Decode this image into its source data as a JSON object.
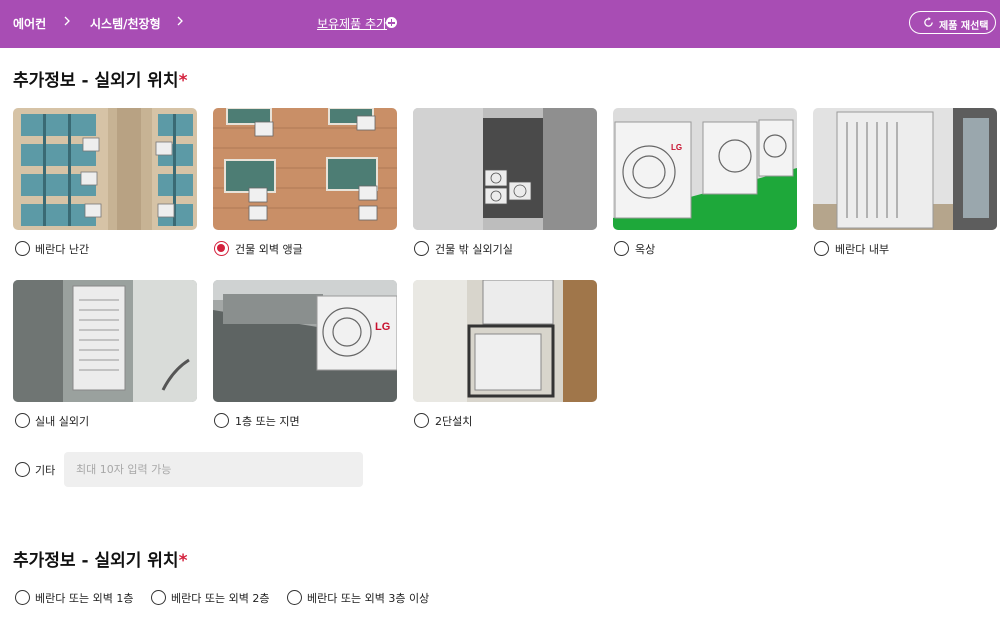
{
  "header": {
    "breadcrumb": [
      "에어컨",
      "시스템/천장형"
    ],
    "add_product": "보유제품 추가",
    "reselect": "제품 재선택"
  },
  "section1": {
    "title": "추가정보 - 실외기 위치",
    "required_mark": "*",
    "options": [
      {
        "label": "베란다 난간",
        "selected": false
      },
      {
        "label": "건물 외벽 앵글",
        "selected": true
      },
      {
        "label": "건물 밖 실외기실",
        "selected": false
      },
      {
        "label": "옥상",
        "selected": false
      },
      {
        "label": "베란다 내부",
        "selected": false
      },
      {
        "label": "실내 실외기",
        "selected": false
      },
      {
        "label": "1층 또는 지면",
        "selected": false
      },
      {
        "label": "2단설치",
        "selected": false
      }
    ],
    "other": {
      "label": "기타",
      "placeholder": "최대 10자 입력 가능",
      "value": ""
    }
  },
  "section2": {
    "title": "추가정보 - 실외기 위치",
    "required_mark": "*",
    "options": [
      {
        "label": "베란다 또는 외벽 1층",
        "selected": false
      },
      {
        "label": "베란다 또는 외벽 2층",
        "selected": false
      },
      {
        "label": "베란다 또는 외벽 3층 이상",
        "selected": false
      }
    ]
  },
  "colors": {
    "header_bg": "#a84db4",
    "accent_red": "#d4213d"
  }
}
